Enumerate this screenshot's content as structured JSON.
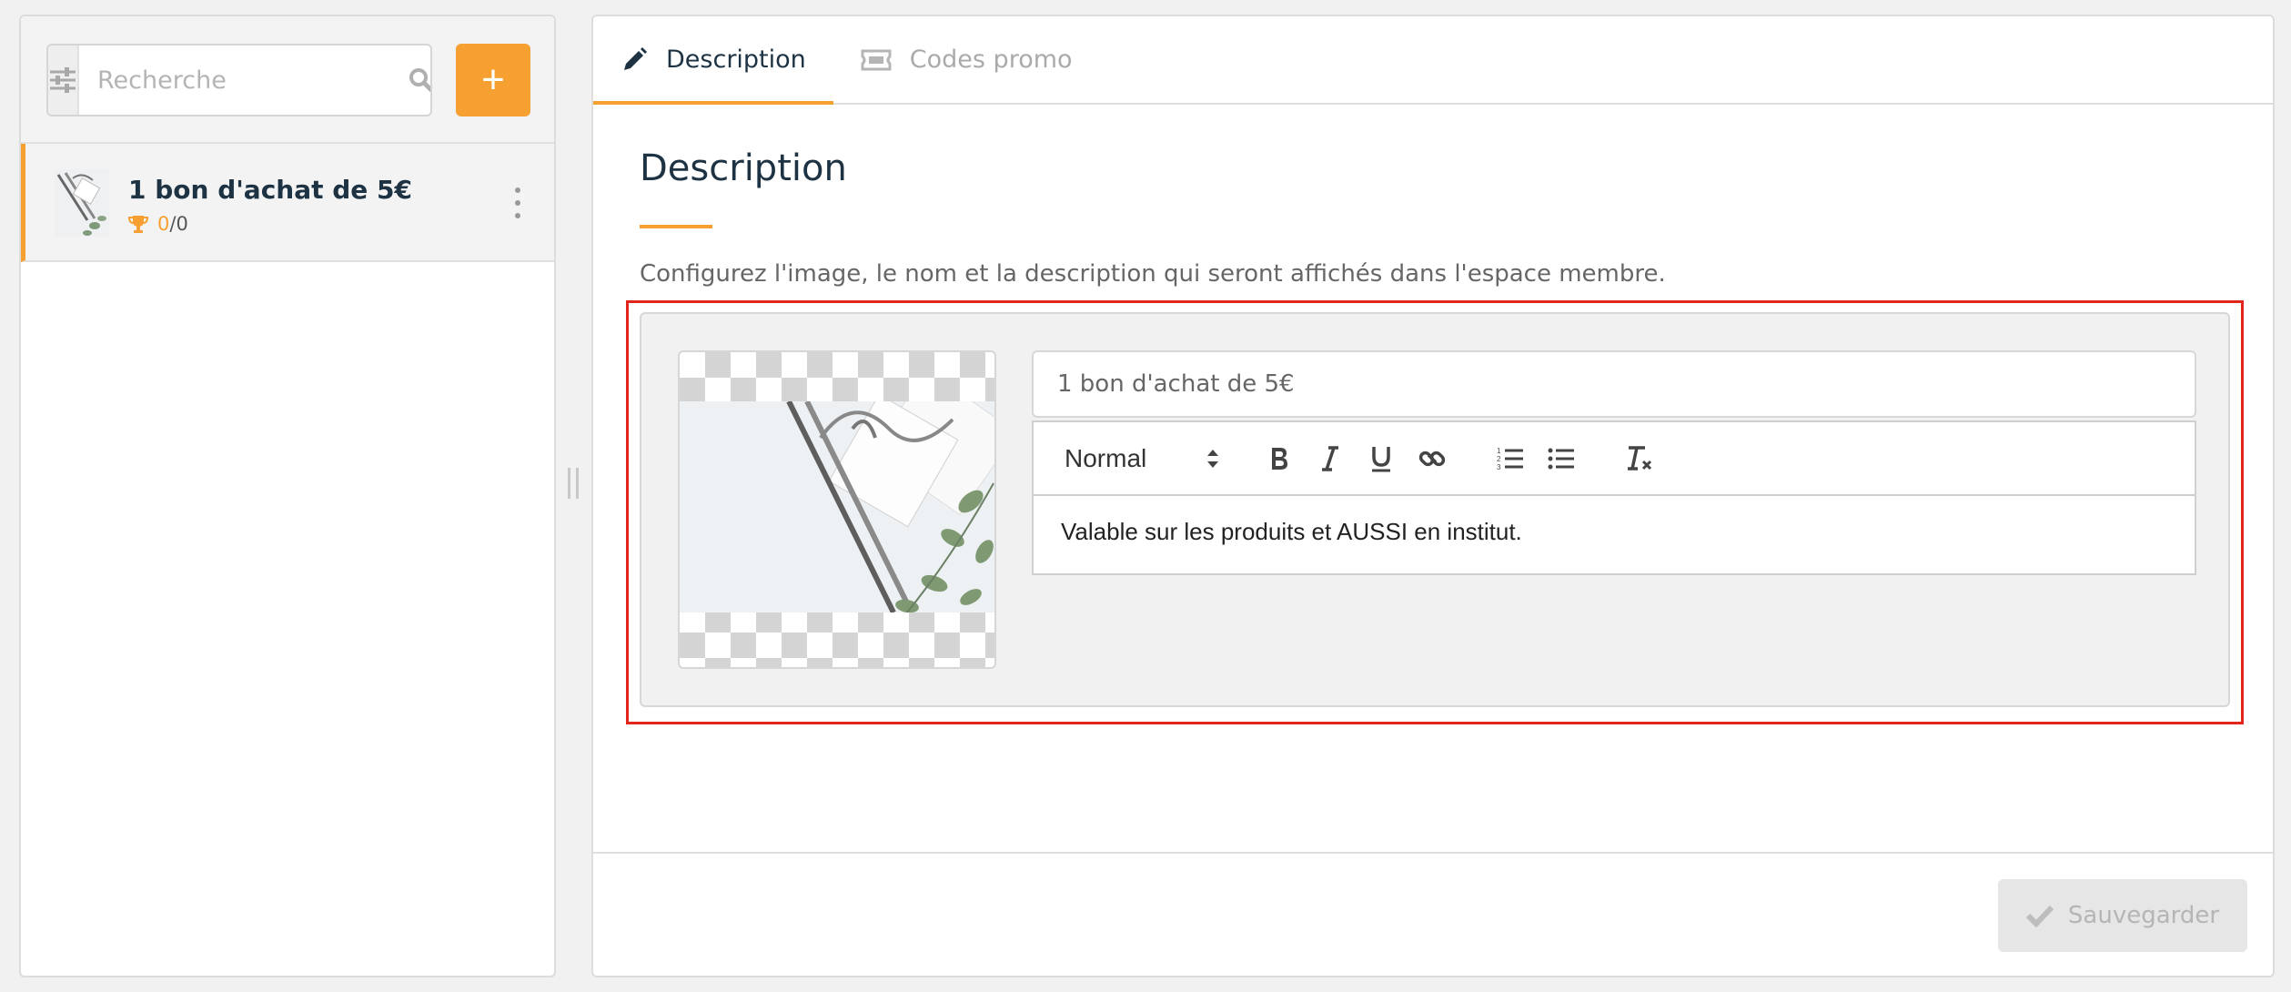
{
  "sidebar": {
    "search_placeholder": "Recherche",
    "add_label": "+",
    "items": [
      {
        "title": "1 bon d'achat de 5€",
        "count_done": "0",
        "count_total": "/0"
      }
    ]
  },
  "tabs": [
    {
      "label": "Description",
      "icon": "pencil-icon",
      "active": true
    },
    {
      "label": "Codes promo",
      "icon": "ticket-icon",
      "active": false
    }
  ],
  "section": {
    "title": "Description",
    "description": "Configurez l'image, le nom et la description qui seront affichés dans l'espace membre."
  },
  "form": {
    "name_value": "1 bon d'achat de 5€",
    "format_value": "Normal",
    "content": "Valable sur les produits et AUSSI en institut."
  },
  "footer": {
    "save_label": "Sauvegarder"
  },
  "colors": {
    "accent": "#f6a032",
    "title": "#1d3344",
    "highlight": "#e1251b"
  }
}
